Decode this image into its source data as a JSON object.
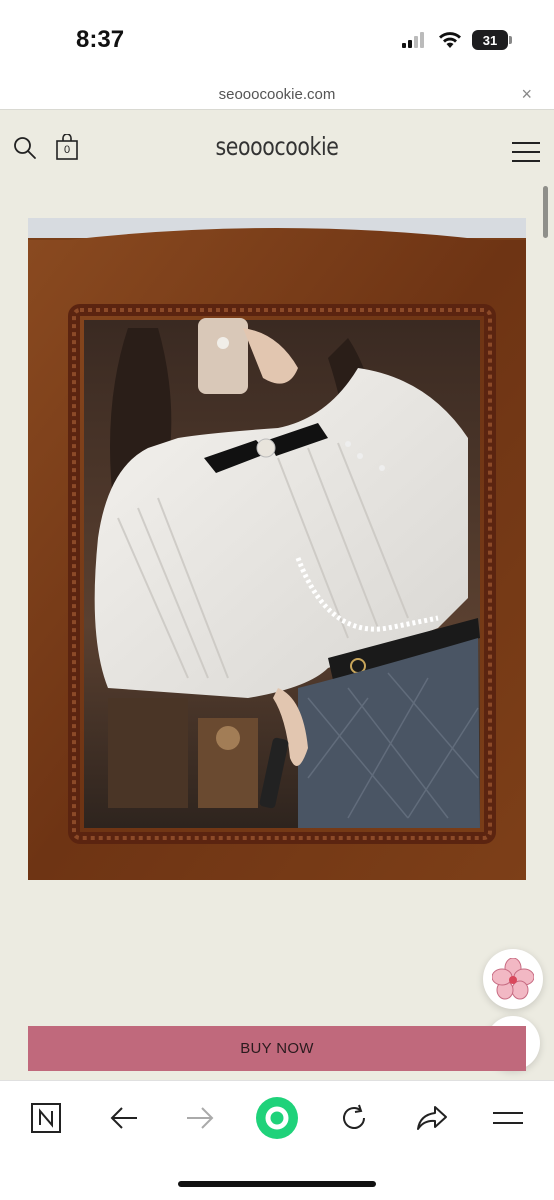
{
  "status_bar": {
    "time": "8:37",
    "battery": "31"
  },
  "url_bar": {
    "url": "seooocookie.com",
    "close_label": "×"
  },
  "site_header": {
    "logo": "seooocookie",
    "cart_count": "0"
  },
  "product": {
    "image_alt": "Woman taking mirror selfie in white ruffled blouse with black bow and denim skirt"
  },
  "buy_now_label": "BUY NOW",
  "colors": {
    "background": "#ecebe1",
    "buy_button": "#c0697c",
    "active_nav": "#1fd27a"
  },
  "bottom_nav": {
    "icons": [
      "naver-n-icon",
      "back-arrow-icon",
      "forward-arrow-icon",
      "green-home-icon",
      "refresh-icon",
      "share-icon",
      "menu-icon"
    ]
  }
}
